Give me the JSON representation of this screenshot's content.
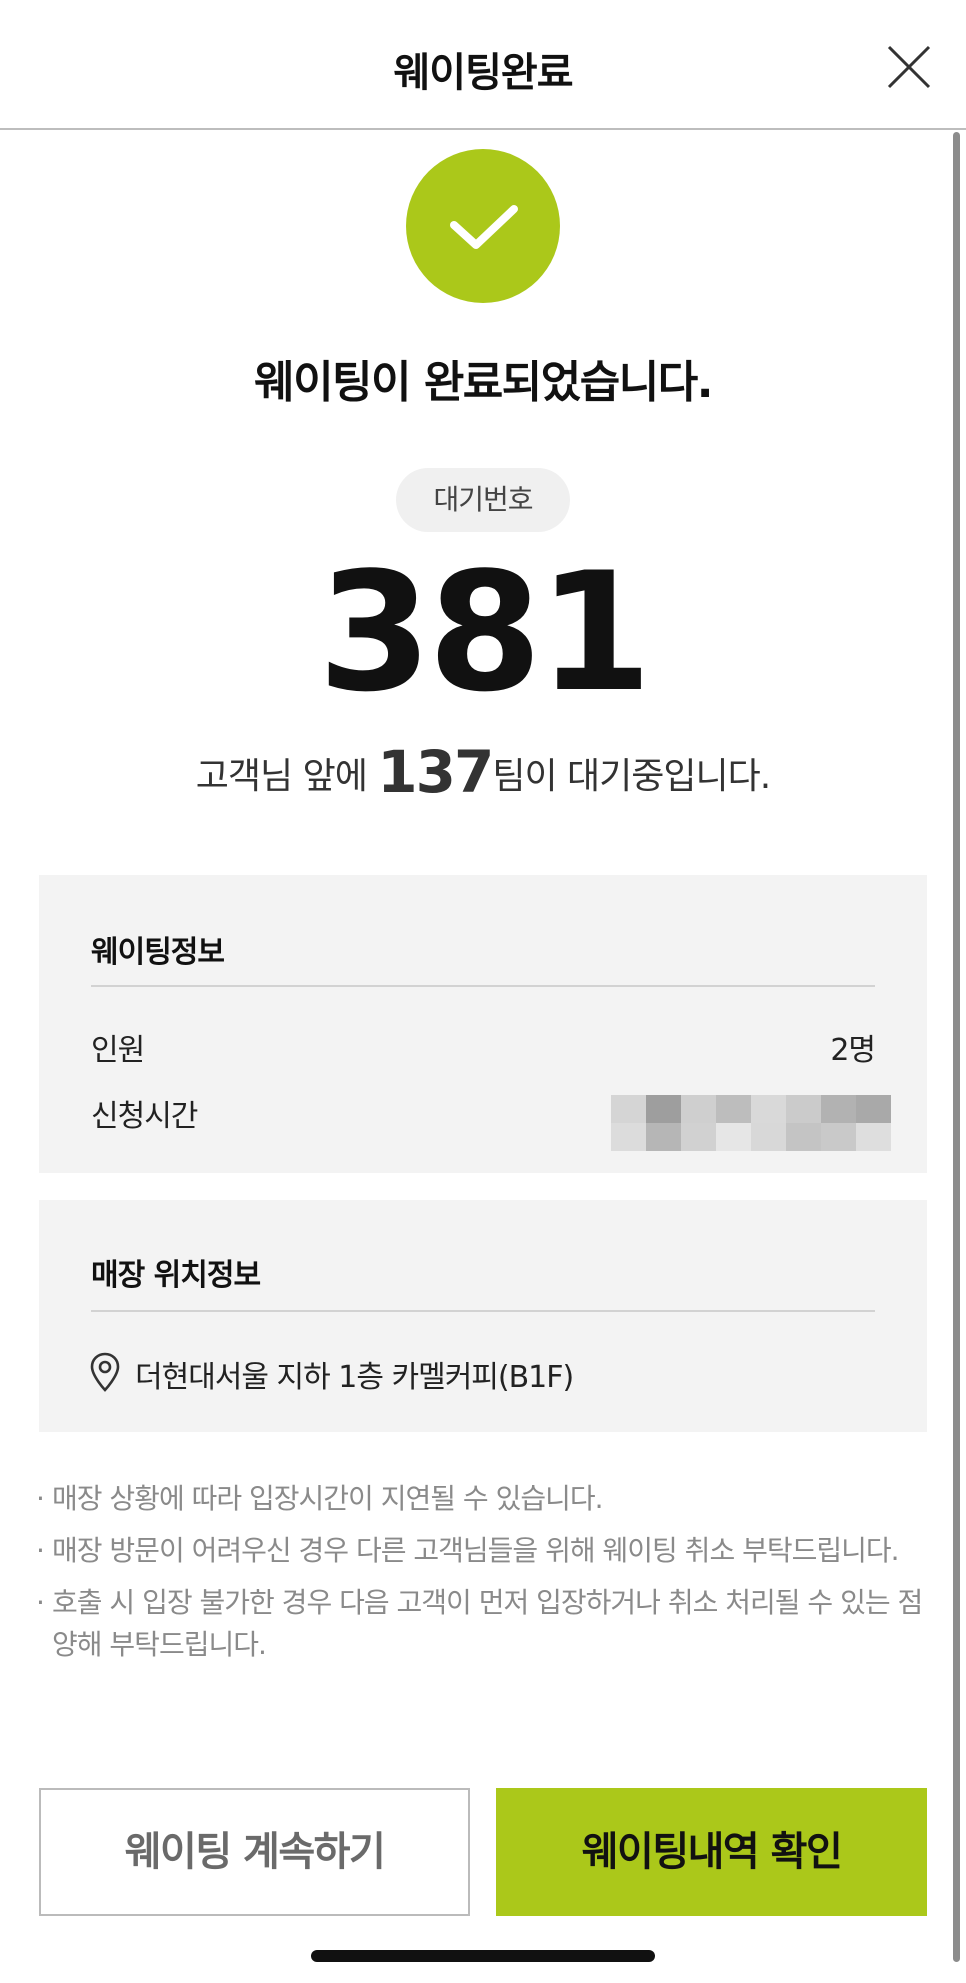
{
  "header": {
    "title": "웨이팅완료",
    "close_icon": "close-icon"
  },
  "status": {
    "icon": "check-icon",
    "accent_color": "#abc81a",
    "title": "웨이팅이 완료되었습니다."
  },
  "waiting": {
    "label": "대기번호",
    "number": "381",
    "ahead_prefix": "고객님 앞에 ",
    "ahead_count": "137",
    "ahead_suffix": "팀이 대기중입니다."
  },
  "waiting_info": {
    "title": "웨이팅정보",
    "rows": [
      {
        "label": "인원",
        "value": "2명"
      },
      {
        "label": "신청시간",
        "value": ""
      }
    ]
  },
  "location_info": {
    "title": "매장 위치정보",
    "icon": "location-pin-icon",
    "address": "더현대서울 지하 1층 카멜커피(B1F)"
  },
  "notes": [
    "매장 상황에 따라 입장시간이 지연될 수 있습니다.",
    "매장 방문이 어려우신 경우 다른 고객님들을 위해 웨이팅 취소 부탁드립니다.",
    "호출 시 입장 불가한 경우 다음 고객이 먼저 입장하거나 취소 처리될 수 있는 점 양해 부탁드립니다."
  ],
  "buttons": {
    "continue_label": "웨이팅 계속하기",
    "history_label": "웨이팅내역 확인"
  }
}
